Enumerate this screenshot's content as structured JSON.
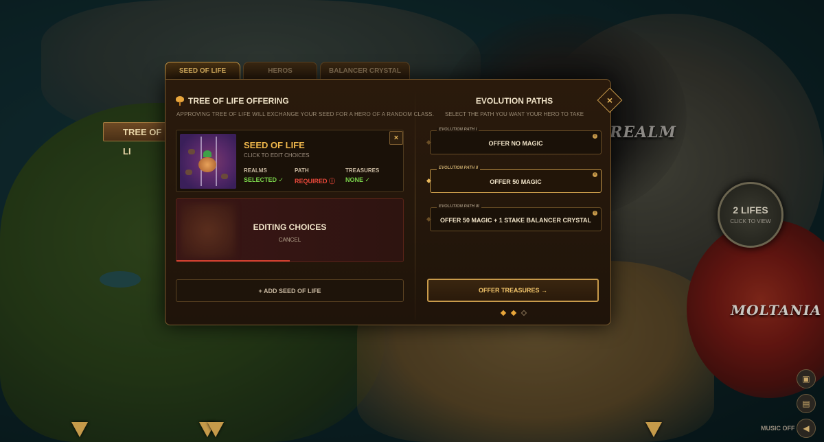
{
  "map": {
    "banner_label": "TREE OF LI",
    "realm_label": "REALM",
    "moltania_label": "MOLTANIA",
    "lifes": {
      "count_label": "2 LIFES",
      "hint": "CLICK TO VIEW"
    },
    "music_label": "MUSIC OFF"
  },
  "tabs": [
    {
      "label": "SEED OF LIFE",
      "active": true
    },
    {
      "label": "HEROS",
      "active": false
    },
    {
      "label": "BALANCER CRYSTAL",
      "active": false
    }
  ],
  "left": {
    "title": "TREE OF LIFE OFFERING",
    "subtitle": "APPROVING TREE OF LIFE WILL EXCHANGE YOUR SEED FOR A HERO OF A RANDOM CLASS.",
    "seed_card": {
      "name": "SEED OF LIFE",
      "hint": "CLICK TO EDIT CHOICES",
      "close": "×",
      "stats": [
        {
          "label": "REALMS",
          "value": "SELECTED ✓",
          "status": "ok"
        },
        {
          "label": "PATH",
          "value": "REQUIRED ⓘ",
          "status": "required"
        },
        {
          "label": "TREASURES",
          "value": "NONE ✓",
          "status": "ok"
        }
      ]
    },
    "editing_card": {
      "title": "EDITING CHOICES",
      "cancel": "CANCEL"
    },
    "add_button": "+   ADD SEED OF LIFE"
  },
  "right": {
    "title": "EVOLUTION PATHS",
    "subtitle": "SELECT THE PATH YOU WANT YOUR HERO TO TAKE",
    "paths": [
      {
        "caption": "EVOLUTION PATH I",
        "label": "OFFER NO MAGIC",
        "selected": false
      },
      {
        "caption": "EVOLUTION PATH II",
        "label": "OFFER 50 MAGIC",
        "selected": true
      },
      {
        "caption": "EVOLUTION PATH III",
        "label": "OFFER 50 MAGIC + 1 STAKE BALANCER CRYSTAL",
        "selected": false
      }
    ],
    "offer_button": "OFFER TREASURES  →",
    "pager": {
      "total": 3,
      "current": 2
    }
  },
  "close_label": "×",
  "colors": {
    "accent": "#f1c46a",
    "ok": "#7ad34a",
    "required": "#e9483a",
    "border": "#c99b4b"
  }
}
